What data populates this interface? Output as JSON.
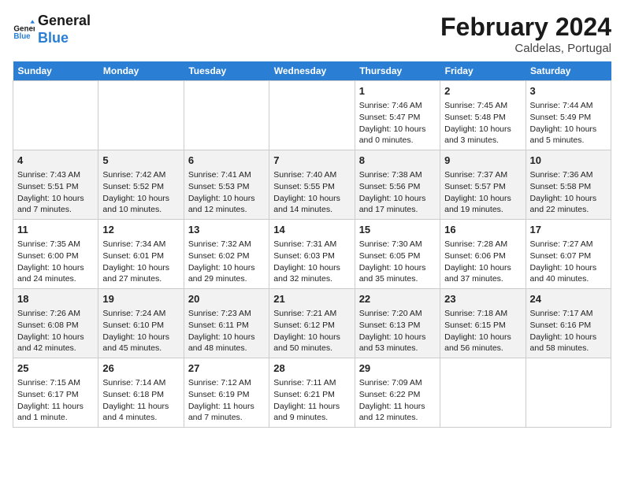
{
  "header": {
    "logo_line1": "General",
    "logo_line2": "Blue",
    "month_year": "February 2024",
    "location": "Caldelas, Portugal"
  },
  "weekdays": [
    "Sunday",
    "Monday",
    "Tuesday",
    "Wednesday",
    "Thursday",
    "Friday",
    "Saturday"
  ],
  "weeks": [
    [
      {
        "day": "",
        "info": ""
      },
      {
        "day": "",
        "info": ""
      },
      {
        "day": "",
        "info": ""
      },
      {
        "day": "",
        "info": ""
      },
      {
        "day": "1",
        "info": "Sunrise: 7:46 AM\nSunset: 5:47 PM\nDaylight: 10 hours and 0 minutes."
      },
      {
        "day": "2",
        "info": "Sunrise: 7:45 AM\nSunset: 5:48 PM\nDaylight: 10 hours and 3 minutes."
      },
      {
        "day": "3",
        "info": "Sunrise: 7:44 AM\nSunset: 5:49 PM\nDaylight: 10 hours and 5 minutes."
      }
    ],
    [
      {
        "day": "4",
        "info": "Sunrise: 7:43 AM\nSunset: 5:51 PM\nDaylight: 10 hours and 7 minutes."
      },
      {
        "day": "5",
        "info": "Sunrise: 7:42 AM\nSunset: 5:52 PM\nDaylight: 10 hours and 10 minutes."
      },
      {
        "day": "6",
        "info": "Sunrise: 7:41 AM\nSunset: 5:53 PM\nDaylight: 10 hours and 12 minutes."
      },
      {
        "day": "7",
        "info": "Sunrise: 7:40 AM\nSunset: 5:55 PM\nDaylight: 10 hours and 14 minutes."
      },
      {
        "day": "8",
        "info": "Sunrise: 7:38 AM\nSunset: 5:56 PM\nDaylight: 10 hours and 17 minutes."
      },
      {
        "day": "9",
        "info": "Sunrise: 7:37 AM\nSunset: 5:57 PM\nDaylight: 10 hours and 19 minutes."
      },
      {
        "day": "10",
        "info": "Sunrise: 7:36 AM\nSunset: 5:58 PM\nDaylight: 10 hours and 22 minutes."
      }
    ],
    [
      {
        "day": "11",
        "info": "Sunrise: 7:35 AM\nSunset: 6:00 PM\nDaylight: 10 hours and 24 minutes."
      },
      {
        "day": "12",
        "info": "Sunrise: 7:34 AM\nSunset: 6:01 PM\nDaylight: 10 hours and 27 minutes."
      },
      {
        "day": "13",
        "info": "Sunrise: 7:32 AM\nSunset: 6:02 PM\nDaylight: 10 hours and 29 minutes."
      },
      {
        "day": "14",
        "info": "Sunrise: 7:31 AM\nSunset: 6:03 PM\nDaylight: 10 hours and 32 minutes."
      },
      {
        "day": "15",
        "info": "Sunrise: 7:30 AM\nSunset: 6:05 PM\nDaylight: 10 hours and 35 minutes."
      },
      {
        "day": "16",
        "info": "Sunrise: 7:28 AM\nSunset: 6:06 PM\nDaylight: 10 hours and 37 minutes."
      },
      {
        "day": "17",
        "info": "Sunrise: 7:27 AM\nSunset: 6:07 PM\nDaylight: 10 hours and 40 minutes."
      }
    ],
    [
      {
        "day": "18",
        "info": "Sunrise: 7:26 AM\nSunset: 6:08 PM\nDaylight: 10 hours and 42 minutes."
      },
      {
        "day": "19",
        "info": "Sunrise: 7:24 AM\nSunset: 6:10 PM\nDaylight: 10 hours and 45 minutes."
      },
      {
        "day": "20",
        "info": "Sunrise: 7:23 AM\nSunset: 6:11 PM\nDaylight: 10 hours and 48 minutes."
      },
      {
        "day": "21",
        "info": "Sunrise: 7:21 AM\nSunset: 6:12 PM\nDaylight: 10 hours and 50 minutes."
      },
      {
        "day": "22",
        "info": "Sunrise: 7:20 AM\nSunset: 6:13 PM\nDaylight: 10 hours and 53 minutes."
      },
      {
        "day": "23",
        "info": "Sunrise: 7:18 AM\nSunset: 6:15 PM\nDaylight: 10 hours and 56 minutes."
      },
      {
        "day": "24",
        "info": "Sunrise: 7:17 AM\nSunset: 6:16 PM\nDaylight: 10 hours and 58 minutes."
      }
    ],
    [
      {
        "day": "25",
        "info": "Sunrise: 7:15 AM\nSunset: 6:17 PM\nDaylight: 11 hours and 1 minute."
      },
      {
        "day": "26",
        "info": "Sunrise: 7:14 AM\nSunset: 6:18 PM\nDaylight: 11 hours and 4 minutes."
      },
      {
        "day": "27",
        "info": "Sunrise: 7:12 AM\nSunset: 6:19 PM\nDaylight: 11 hours and 7 minutes."
      },
      {
        "day": "28",
        "info": "Sunrise: 7:11 AM\nSunset: 6:21 PM\nDaylight: 11 hours and 9 minutes."
      },
      {
        "day": "29",
        "info": "Sunrise: 7:09 AM\nSunset: 6:22 PM\nDaylight: 11 hours and 12 minutes."
      },
      {
        "day": "",
        "info": ""
      },
      {
        "day": "",
        "info": ""
      }
    ]
  ]
}
